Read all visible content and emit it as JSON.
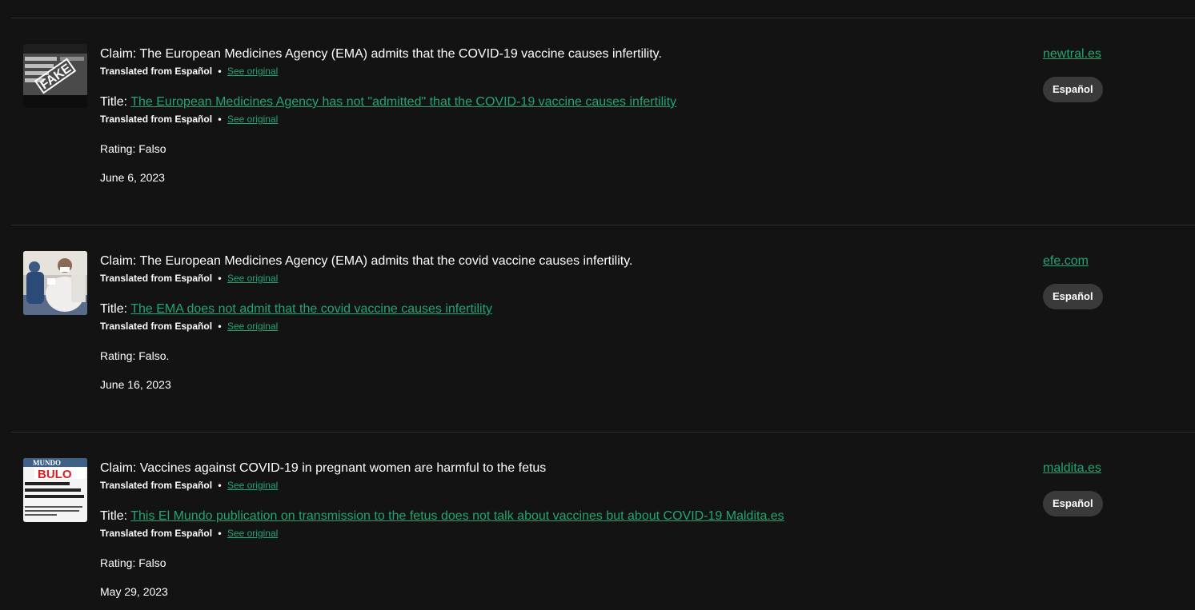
{
  "labels": {
    "claim_prefix": "Claim: ",
    "title_prefix": "Title: ",
    "translated_from": "Translated from Español",
    "bullet": "•",
    "see_original": "See original"
  },
  "thumbnails": {
    "fake_stamp": "FAKE",
    "mundo_masthead": "MUNDO",
    "bulo_stamp": "BULO"
  },
  "items": [
    {
      "claim": "The European Medicines Agency (EMA) admits that the COVID-19 vaccine causes infertility.",
      "title": "The European Medicines Agency has not \"admitted\" that the COVID-19 vaccine causes infertility",
      "rating": "Rating: Falso",
      "date": "June 6, 2023",
      "source": "newtral.es",
      "language": "Español",
      "thumb_icon": "fake-newspaper-thumbnail"
    },
    {
      "claim": "The European Medicines Agency (EMA) admits that the covid vaccine causes infertility.",
      "title": "The EMA does not admit that the covid vaccine causes infertility",
      "rating": "Rating: Falso.",
      "date": "June 16, 2023",
      "source": "efe.com",
      "language": "Español",
      "thumb_icon": "pregnant-woman-vaccination-thumbnail"
    },
    {
      "claim": "Vaccines against COVID-19 in pregnant women are harmful to the fetus",
      "title": "This El Mundo publication on transmission to the fetus does not talk about vaccines but about COVID-19 Maldita.es",
      "rating": "Rating: Falso",
      "date": "May 29, 2023",
      "source": "maldita.es",
      "language": "Español",
      "thumb_icon": "el-mundo-bulo-thumbnail"
    }
  ],
  "colors": {
    "background": "#131313",
    "link": "#20a672",
    "pill": "#3a3a3a",
    "divider": "#2e2e2e"
  }
}
